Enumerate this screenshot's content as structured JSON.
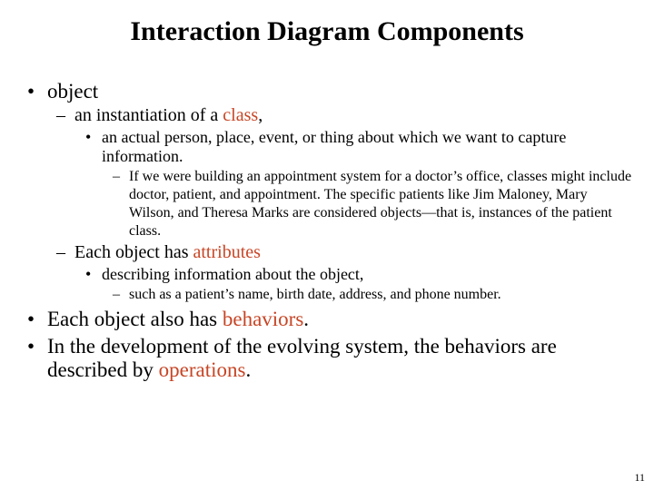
{
  "title": "Interaction Diagram Components",
  "b1": {
    "object": "object",
    "instantiation_pre": "an instantiation of a ",
    "instantiation_accent": "class",
    "instantiation_post": ",",
    "actual": "an actual person, place, event, or thing about which we want to capture information.",
    "example": "If we were building an appointment system for a doctor’s office, classes might include doctor, patient, and appointment. The specific patients like Jim Maloney, Mary Wilson, and Theresa Marks are considered objects—that is, instances of the patient class.",
    "each_obj_pre": "Each object has ",
    "each_obj_accent": "attributes",
    "describing": "describing information about the object,",
    "such_as": "such as a patient’s name, birth date, address, and phone number."
  },
  "b2": {
    "pre": "Each object also has ",
    "accent": "behaviors",
    "post": "."
  },
  "b3": {
    "pre": "In the development of the evolving system, the behaviors are described by ",
    "accent": "operations",
    "post": "."
  },
  "page": "11"
}
